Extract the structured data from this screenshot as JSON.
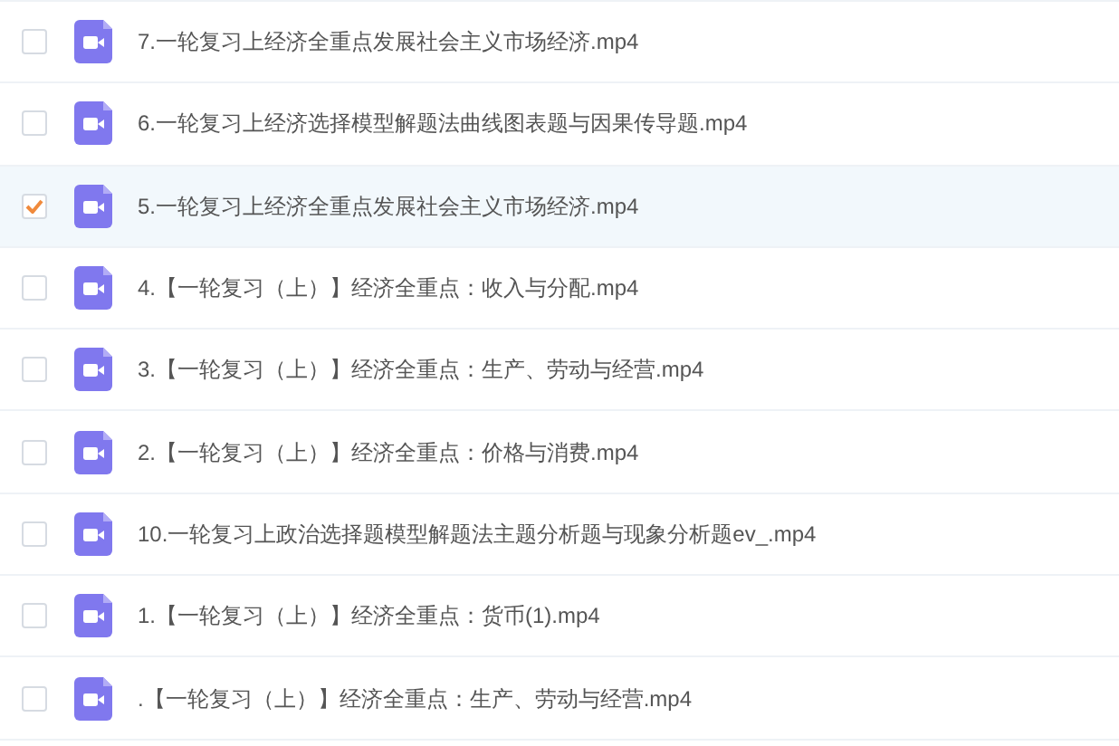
{
  "files": [
    {
      "name": "7.一轮复习上经济全重点发展社会主义市场经济.mp4",
      "selected": false
    },
    {
      "name": "6.一轮复习上经济选择模型解题法曲线图表题与因果传导题.mp4",
      "selected": false
    },
    {
      "name": "5.一轮复习上经济全重点发展社会主义市场经济.mp4",
      "selected": true
    },
    {
      "name": "4.【一轮复习（上）】经济全重点：收入与分配.mp4",
      "selected": false
    },
    {
      "name": "3.【一轮复习（上）】经济全重点：生产、劳动与经营.mp4",
      "selected": false
    },
    {
      "name": "2.【一轮复习（上）】经济全重点：价格与消费.mp4",
      "selected": false
    },
    {
      "name": "10.一轮复习上政治选择题模型解题法主题分析题与现象分析题ev_.mp4",
      "selected": false
    },
    {
      "name": "1.【一轮复习（上）】经济全重点：货币(1).mp4",
      "selected": false
    },
    {
      "name": ".【一轮复习（上）】经济全重点：生产、劳动与经营.mp4",
      "selected": false
    }
  ]
}
